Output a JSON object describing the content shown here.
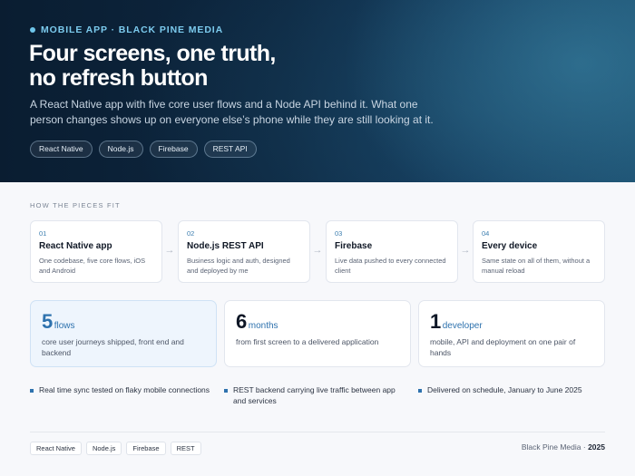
{
  "hero": {
    "eyebrow": "MOBILE APP · BLACK PINE MEDIA",
    "title_line1": "Four screens, one truth,",
    "title_line2": "no refresh button",
    "lead": "A React Native app with five core user flows and a Node API behind it. What one person changes shows up on everyone else’s phone while they are still looking at it.",
    "tags": [
      "React Native",
      "Node.js",
      "Firebase",
      "REST API"
    ]
  },
  "pieces": {
    "label": "HOW THE PIECES FIT",
    "steps": [
      {
        "num": "01",
        "name": "React Native app",
        "desc": "One codebase, five core flows, iOS and Android"
      },
      {
        "num": "02",
        "name": "Node.js REST API",
        "desc": "Business logic and auth, designed and deployed by me"
      },
      {
        "num": "03",
        "name": "Firebase",
        "desc": "Live data pushed to every connected client"
      },
      {
        "num": "04",
        "name": "Every device",
        "desc": "Same state on all of them, without a manual reload"
      }
    ],
    "arrow": "→"
  },
  "stats": [
    {
      "value": "5",
      "unit": "flows",
      "desc": "core user journeys shipped, front end and backend"
    },
    {
      "value": "6",
      "unit": "months",
      "desc": "from first screen to a delivered application"
    },
    {
      "value": "1",
      "unit": "developer",
      "desc": "mobile, API and deployment on one pair of hands"
    }
  ],
  "bullets": [
    "Real time sync tested on flaky mobile connections",
    "REST backend carrying live traffic between app and services",
    "Delivered on schedule, January to June 2025"
  ],
  "footer": {
    "tags": [
      "React Native",
      "Node.js",
      "Firebase",
      "REST"
    ],
    "credit": "Black Pine Media ·",
    "year": "2025"
  },
  "colors": {
    "accent": "#2e72ae",
    "eyebrow": "#7ccbee",
    "hero_bg": "#0d2740"
  }
}
